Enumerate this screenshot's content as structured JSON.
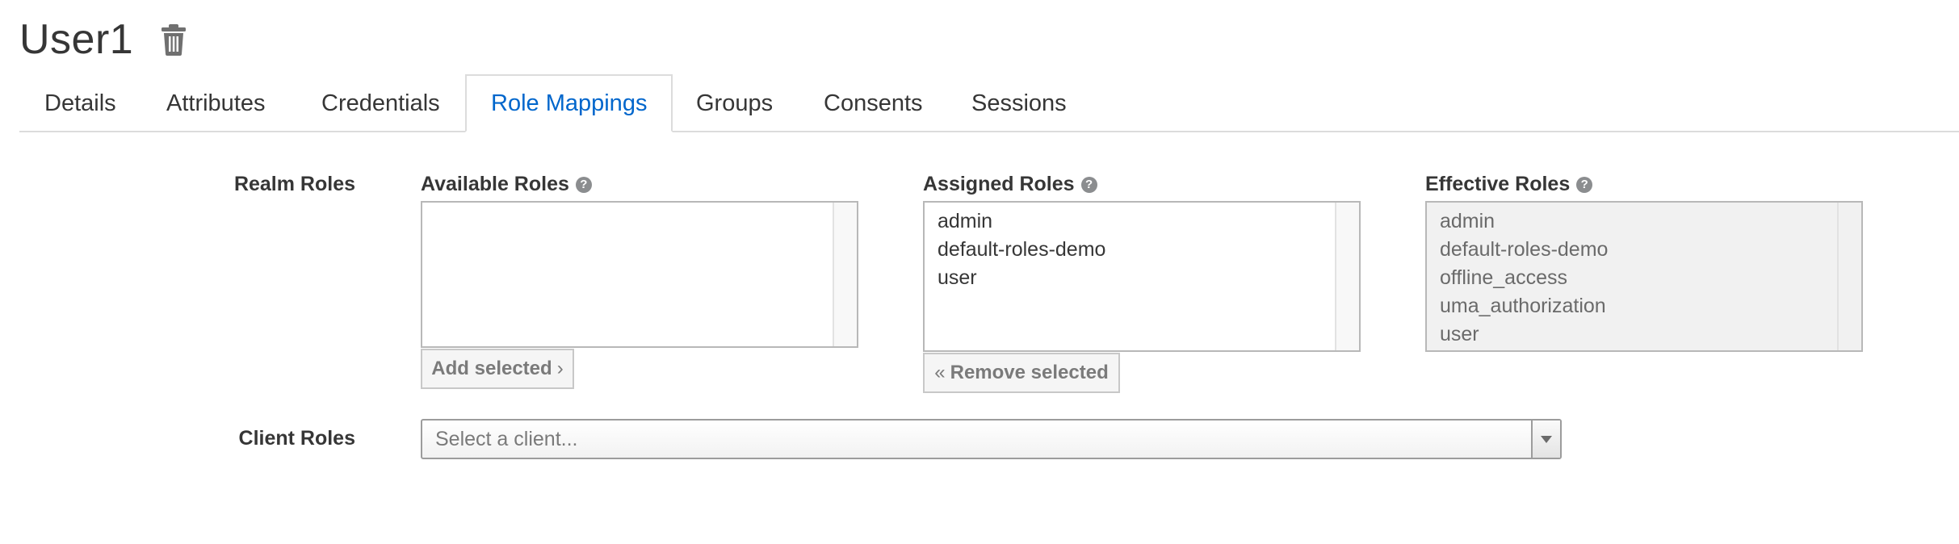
{
  "page": {
    "title": "User1"
  },
  "icons": {
    "delete": "trash-icon",
    "help": "question-circle-icon",
    "add": "angle-right-icon",
    "remove": "angle-double-left-icon",
    "dropdown": "caret-down-icon"
  },
  "tabs": [
    {
      "label": "Details",
      "active": false
    },
    {
      "label": "Attributes",
      "active": false
    },
    {
      "label": "Credentials",
      "active": false
    },
    {
      "label": "Role Mappings",
      "active": true
    },
    {
      "label": "Groups",
      "active": false
    },
    {
      "label": "Consents",
      "active": false
    },
    {
      "label": "Sessions",
      "active": false
    }
  ],
  "colors": {
    "active_tab": "#0066cc",
    "text": "#363636",
    "help_icon": "#8b8d8f"
  },
  "realm_roles": {
    "label": "Realm Roles",
    "available": {
      "label": "Available Roles",
      "items": [],
      "button": "Add selected"
    },
    "assigned": {
      "label": "Assigned Roles",
      "items": [
        "admin",
        "default-roles-demo",
        "user"
      ],
      "button": "Remove selected"
    },
    "effective": {
      "label": "Effective Roles",
      "items": [
        "admin",
        "default-roles-demo",
        "offline_access",
        "uma_authorization",
        "user"
      ]
    }
  },
  "client_roles": {
    "label": "Client Roles",
    "placeholder": "Select a client..."
  }
}
